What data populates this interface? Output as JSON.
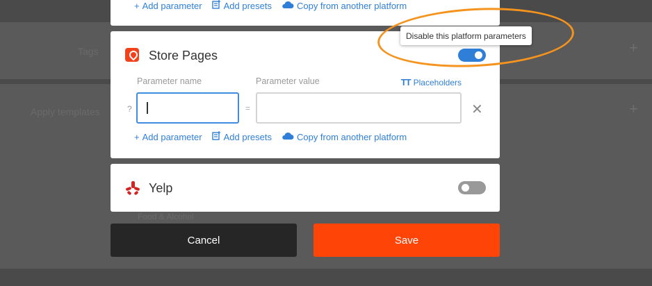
{
  "background": {
    "row1_label": "Tags",
    "row2_label": "Apply templates",
    "row3_label": "Food & Alcohol",
    "plus_symbol": "+"
  },
  "top_card": {
    "add_parameter": "Add parameter",
    "add_presets": "Add presets",
    "copy_platform": "Copy from another platform"
  },
  "store_card": {
    "title": "Store Pages",
    "toggle_on": true,
    "param_name_label": "Parameter name",
    "param_value_label": "Parameter value",
    "placeholders_label": "Placeholders",
    "placeholders_glyph": "TT",
    "question_mark": "?",
    "equals": "=",
    "name_value": "",
    "value_value": "",
    "add_parameter": "Add parameter",
    "add_presets": "Add presets",
    "copy_platform": "Copy from another platform"
  },
  "yelp_card": {
    "title": "Yelp",
    "toggle_on": false
  },
  "buttons": {
    "cancel": "Cancel",
    "save": "Save"
  },
  "tooltip": {
    "text": "Disable this platform parameters"
  },
  "colors": {
    "accent_blue": "#2f7fd8",
    "save_orange": "#ff4408",
    "annotation_orange": "#f4931d",
    "store_red": "#f2421b",
    "yelp_red": "#d32323"
  }
}
